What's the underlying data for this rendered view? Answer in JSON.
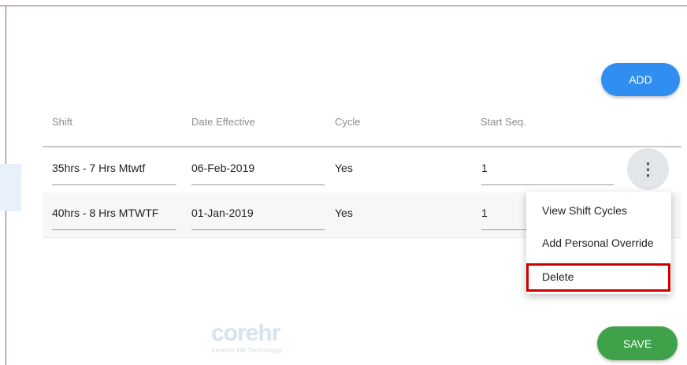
{
  "actions": {
    "add_label": "ADD",
    "save_label": "SAVE"
  },
  "table": {
    "headers": [
      "Shift",
      "Date Effective",
      "Cycle",
      "Start Seq."
    ],
    "rows": [
      {
        "shift": "35hrs - 7 Hrs Mtwtf",
        "date": "06-Feb-2019",
        "cycle": "Yes",
        "start_seq": "1"
      },
      {
        "shift": "40hrs - 8 Hrs MTWTF",
        "date": "01-Jan-2019",
        "cycle": "Yes",
        "start_seq": "1"
      }
    ]
  },
  "row_menu": {
    "icon": "more-vertical-icon",
    "glyph": "⋮",
    "items": [
      "View Shift Cycles",
      "Add Personal Override",
      "Delete"
    ],
    "highlighted_item": "Delete",
    "highlight_color": "#cc0000"
  },
  "branding": {
    "logo_text": "corehr",
    "tagline": "Smarter HR Technology"
  },
  "colors": {
    "add_button": "#2f8ef0",
    "save_button": "#3fa24a",
    "frame": "#9b4f9b"
  }
}
